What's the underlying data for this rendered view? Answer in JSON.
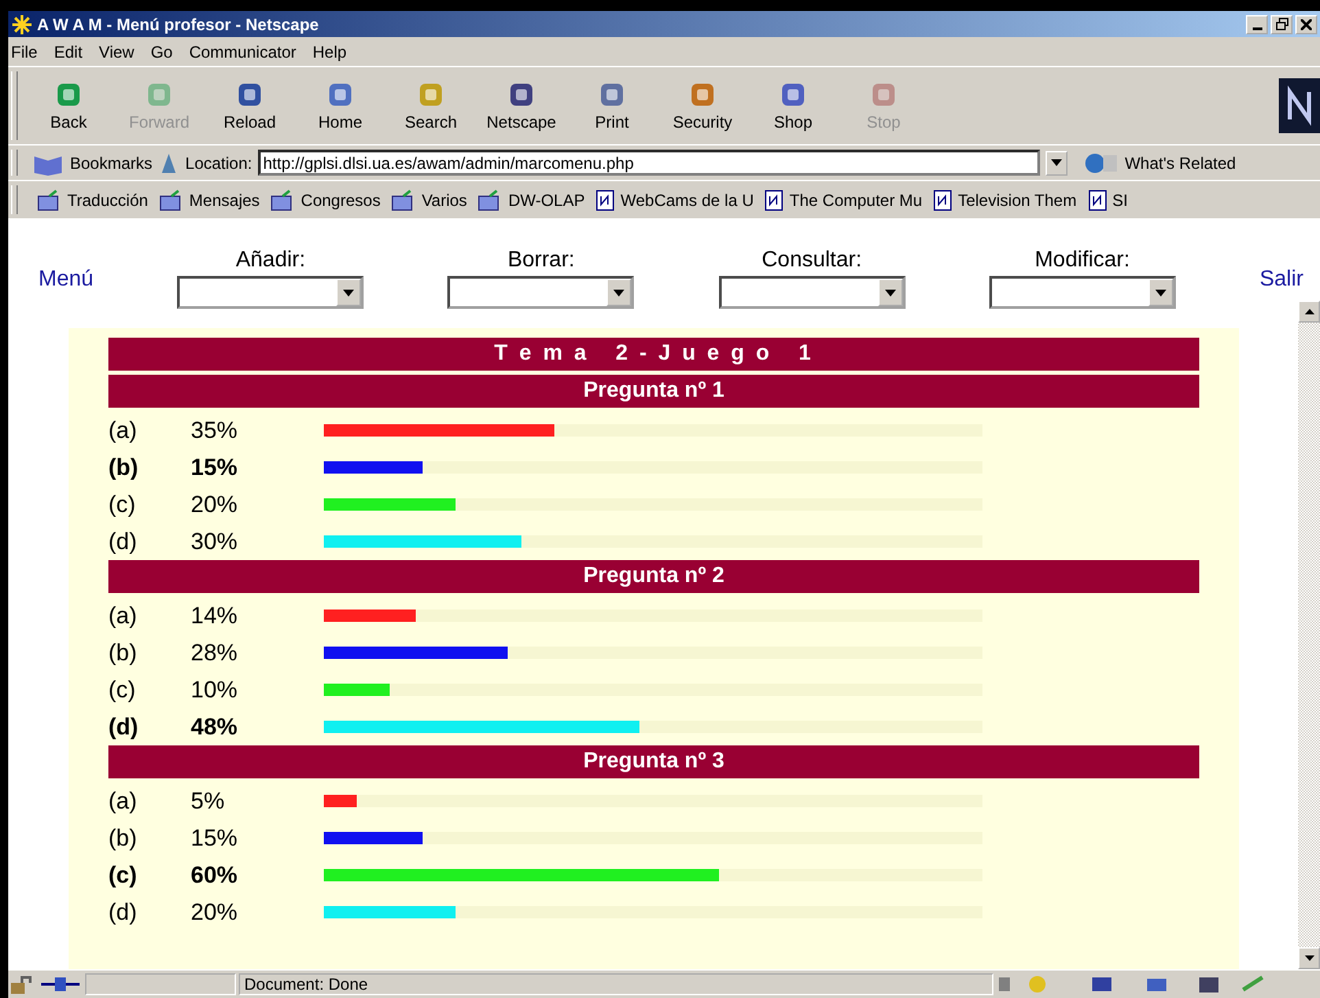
{
  "window": {
    "title": "A W A M - Menú profesor - Netscape"
  },
  "menu": [
    "File",
    "Edit",
    "View",
    "Go",
    "Communicator",
    "Help"
  ],
  "toolbar": [
    {
      "label": "Back",
      "disabled": false
    },
    {
      "label": "Forward",
      "disabled": true
    },
    {
      "label": "Reload",
      "disabled": false
    },
    {
      "label": "Home",
      "disabled": false
    },
    {
      "label": "Search",
      "disabled": false
    },
    {
      "label": "Netscape",
      "disabled": false
    },
    {
      "label": "Print",
      "disabled": false
    },
    {
      "label": "Security",
      "disabled": false
    },
    {
      "label": "Shop",
      "disabled": false
    },
    {
      "label": "Stop",
      "disabled": true
    }
  ],
  "location_bar": {
    "bookmarks": "Bookmarks",
    "location_label": "Location:",
    "url": "http://gplsi.dlsi.ua.es/awam/admin/marcomenu.php",
    "related": "What's Related"
  },
  "personal_toolbar": [
    {
      "label": "Traducción",
      "kind": "folder"
    },
    {
      "label": "Mensajes",
      "kind": "folder"
    },
    {
      "label": "Congresos",
      "kind": "folder"
    },
    {
      "label": "Varios",
      "kind": "folder"
    },
    {
      "label": "DW-OLAP",
      "kind": "folder"
    },
    {
      "label": "WebCams de la U",
      "kind": "page"
    },
    {
      "label": "The Computer Mu",
      "kind": "page"
    },
    {
      "label": "Television Them",
      "kind": "page"
    },
    {
      "label": "SI",
      "kind": "page"
    }
  ],
  "nav": {
    "menu_link": "Menú",
    "exit_link": "Salir",
    "selects": [
      "Añadir:",
      "Borrar:",
      "Consultar:",
      "Modificar:"
    ]
  },
  "title": "T e m a   2 - J u e g o   1",
  "questions": [
    {
      "heading": "Pregunta nº 1",
      "answers": [
        {
          "option": "(a)",
          "percent": "35%",
          "level": 0.35,
          "color": "#ff2020",
          "correct": false
        },
        {
          "option": "(b)",
          "percent": "15%",
          "level": 0.15,
          "color": "#1010f0",
          "correct": true
        },
        {
          "option": "(c)",
          "percent": "20%",
          "level": 0.2,
          "color": "#20f020",
          "correct": false
        },
        {
          "option": "(d)",
          "percent": "30%",
          "level": 0.3,
          "color": "#10f0f0",
          "correct": false
        }
      ]
    },
    {
      "heading": "Pregunta nº 2",
      "answers": [
        {
          "option": "(a)",
          "percent": "14%",
          "level": 0.14,
          "color": "#ff2020",
          "correct": false
        },
        {
          "option": "(b)",
          "percent": "28%",
          "level": 0.28,
          "color": "#1010f0",
          "correct": false
        },
        {
          "option": "(c)",
          "percent": "10%",
          "level": 0.1,
          "color": "#20f020",
          "correct": false
        },
        {
          "option": "(d)",
          "percent": "48%",
          "level": 0.48,
          "color": "#10f0f0",
          "correct": true
        }
      ]
    },
    {
      "heading": "Pregunta nº 3",
      "answers": [
        {
          "option": "(a)",
          "percent": "5%",
          "level": 0.05,
          "color": "#ff2020",
          "correct": false
        },
        {
          "option": "(b)",
          "percent": "15%",
          "level": 0.15,
          "color": "#1010f0",
          "correct": false
        },
        {
          "option": "(c)",
          "percent": "60%",
          "level": 0.6,
          "color": "#20f020",
          "correct": true
        },
        {
          "option": "(d)",
          "percent": "20%",
          "level": 0.2,
          "color": "#10f0f0",
          "correct": false
        }
      ]
    }
  ],
  "status_bar": {
    "text": "Document: Done"
  }
}
